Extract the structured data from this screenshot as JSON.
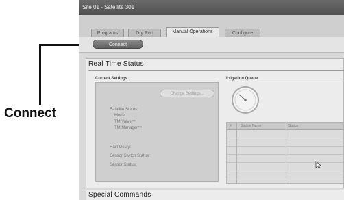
{
  "callout": {
    "label": "Connect"
  },
  "window": {
    "title": "Site 01 - Satellite 301"
  },
  "tabs": [
    {
      "label": "Programs"
    },
    {
      "label": "Dry Run"
    },
    {
      "label": "Manual Operations"
    },
    {
      "label": "Configure"
    }
  ],
  "toolbar": {
    "connect_label": "Connect"
  },
  "real_time_status": {
    "title": "Real Time Status",
    "current_settings": {
      "heading": "Current Settings",
      "change_button": "Change Settings...",
      "labels": [
        "Satellite Status:",
        "Mode:",
        "TM Valve™",
        "TM Manager™",
        "Rain Delay:",
        "Sensor Switch Status:",
        "Sensor Status:"
      ]
    },
    "irrigation_queue": {
      "heading": "Irrigation Queue",
      "columns": [
        "#",
        "Station Name",
        "Status"
      ]
    }
  },
  "special_commands": {
    "title": "Special Commands"
  }
}
